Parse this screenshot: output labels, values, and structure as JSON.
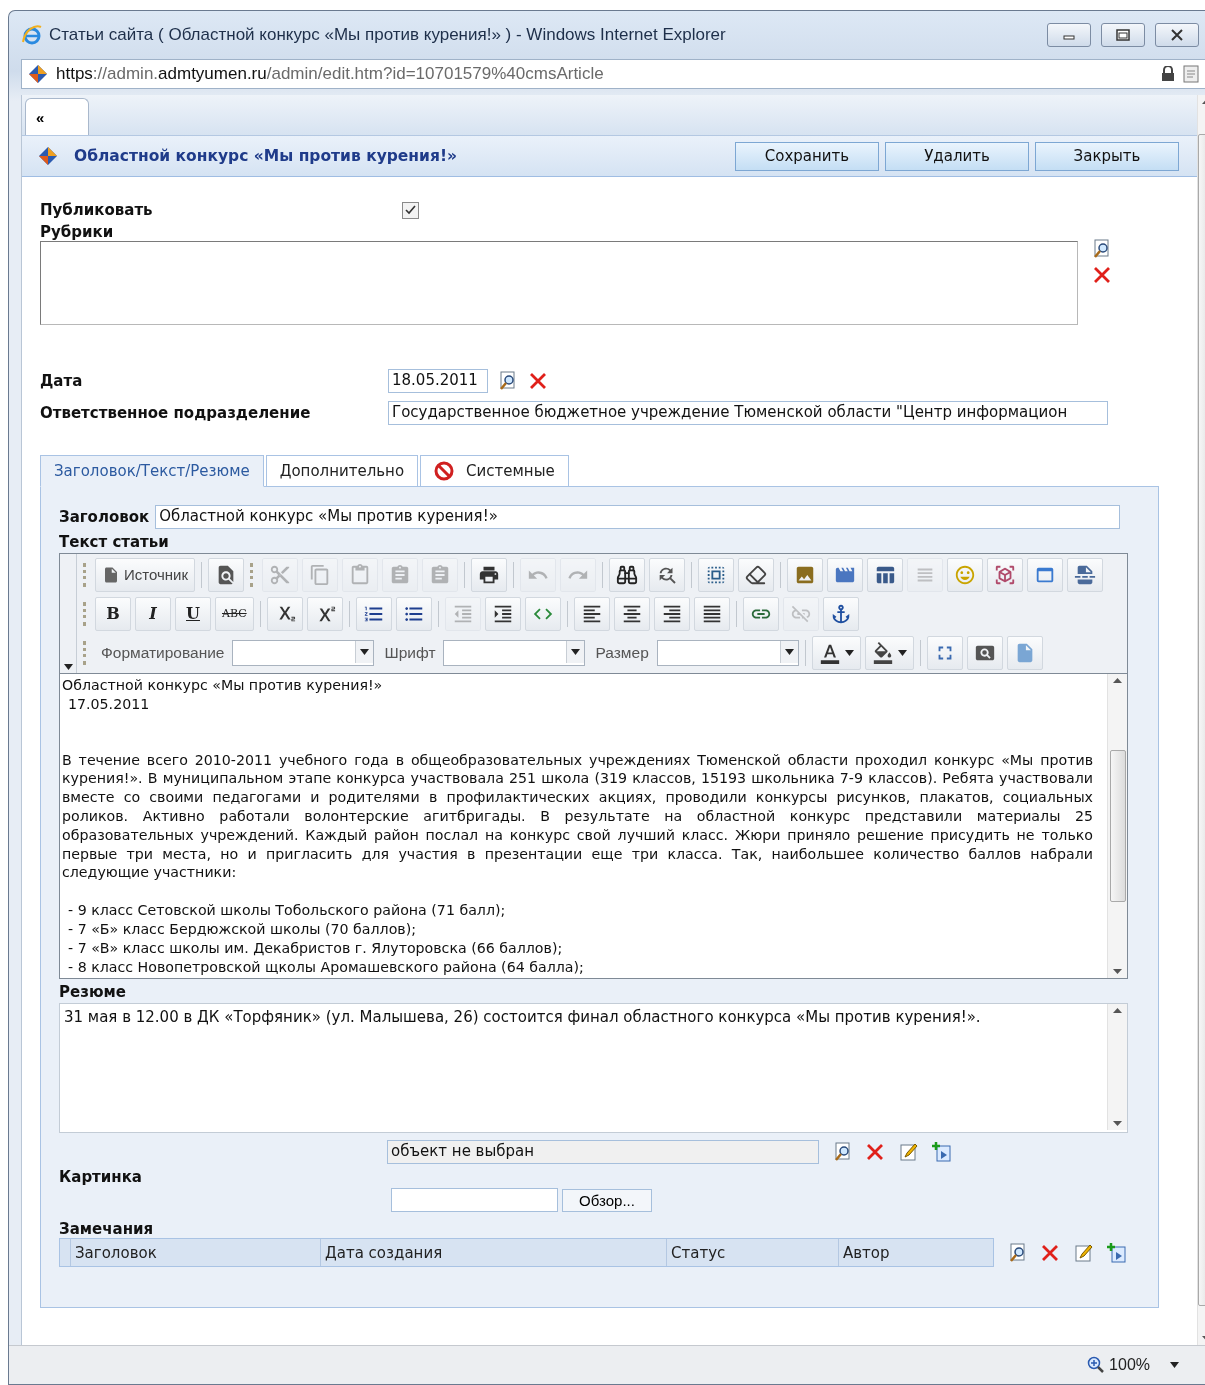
{
  "window": {
    "title": "Статьи сайта ( Областной конкурс «Мы против курения!» ) - Windows Internet Explorer"
  },
  "address_bar": {
    "url": "**https**://admin.**admtyumen.ru**/admin/edit.htm?id=10701579%40cmsArticle"
  },
  "nav_tab": {
    "label": "«"
  },
  "header": {
    "title": "Областной конкурс «Мы против курения!»",
    "buttons": [
      "Сохранить",
      "Удалить",
      "Закрыть"
    ]
  },
  "form": {
    "publish": {
      "label": "Публиковать",
      "checked": true
    },
    "rubrics": {
      "label": "Рубрики"
    },
    "date": {
      "label": "Дата",
      "value": "18.05.2011"
    },
    "department": {
      "label": "Ответственное подразделение",
      "value": "Государственное бюджетное учреждение Тюменской области \"Центр информацион"
    }
  },
  "tabs": [
    {
      "label": "Заголовок/Текст/Резюме",
      "selected": true,
      "kind": "plain"
    },
    {
      "label": "Дополнительно",
      "selected": false,
      "kind": "plain"
    },
    {
      "label": "Системные",
      "selected": false,
      "kind": "icon"
    }
  ],
  "article": {
    "title_label": "Заголовок",
    "title_value": "Областной конкурс «Мы против курения!»",
    "text_label": "Текст статьи",
    "editor": {
      "toolbar": [
        [
          {
            "kind": "grip"
          },
          {
            "kind": "button",
            "label": "Источник"
          },
          {
            "kind": "sep"
          },
          {
            "kind": "icon",
            "disabled": false
          },
          {
            "kind": "grip"
          },
          {
            "kind": "icon",
            "disabled": true
          },
          {
            "kind": "icon",
            "disabled": true
          },
          {
            "kind": "icon",
            "disabled": true
          },
          {
            "kind": "icon",
            "disabled": true
          },
          {
            "kind": "icon",
            "disabled": true
          },
          {
            "kind": "sep"
          },
          {
            "kind": "icon",
            "disabled": false
          },
          {
            "kind": "sep"
          },
          {
            "kind": "icon",
            "disabled": true
          },
          {
            "kind": "icon",
            "disabled": true
          },
          {
            "kind": "sep"
          },
          {
            "kind": "icon",
            "disabled": false
          },
          {
            "kind": "icon",
            "disabled": false
          },
          {
            "kind": "sep"
          },
          {
            "kind": "icon",
            "disabled": false
          },
          {
            "kind": "icon",
            "disabled": false
          },
          {
            "kind": "sep"
          },
          {
            "kind": "icon",
            "disabled": false
          },
          {
            "kind": "icon",
            "disabled": false
          },
          {
            "kind": "icon",
            "disabled": false
          },
          {
            "kind": "icon",
            "disabled": true
          },
          {
            "kind": "icon",
            "disabled": false
          },
          {
            "kind": "icon",
            "disabled": false
          },
          {
            "kind": "icon",
            "disabled": false
          },
          {
            "kind": "icon",
            "disabled": false
          }
        ],
        [
          {
            "kind": "grip"
          },
          {
            "kind": "bold",
            "label": "B"
          },
          {
            "kind": "italic",
            "label": "I"
          },
          {
            "kind": "underline",
            "label": "U"
          },
          {
            "kind": "strike",
            "label": "ABC"
          },
          {
            "kind": "sep"
          },
          {
            "kind": "icon",
            "disabled": false
          },
          {
            "kind": "icon",
            "disabled": false
          },
          {
            "kind": "sep"
          },
          {
            "kind": "icon",
            "disabled": false
          },
          {
            "kind": "icon",
            "disabled": false
          },
          {
            "kind": "sep"
          },
          {
            "kind": "icon",
            "disabled": true
          },
          {
            "kind": "icon",
            "disabled": false
          },
          {
            "kind": "icon",
            "disabled": false
          },
          {
            "kind": "sep"
          },
          {
            "kind": "icon",
            "disabled": false
          },
          {
            "kind": "icon",
            "disabled": false
          },
          {
            "kind": "icon",
            "disabled": false
          },
          {
            "kind": "icon",
            "disabled": false
          },
          {
            "kind": "sep"
          },
          {
            "kind": "icon",
            "disabled": false
          },
          {
            "kind": "icon",
            "disabled": true
          },
          {
            "kind": "icon",
            "disabled": false
          }
        ],
        [
          {
            "kind": "grip"
          },
          {
            "kind": "combo",
            "label": "Форматирование"
          },
          {
            "kind": "combo",
            "label": "Шрифт"
          },
          {
            "kind": "combo",
            "label": "Размер"
          },
          {
            "kind": "sep"
          },
          {
            "kind": "icon_menu",
            "disabled": false
          },
          {
            "kind": "icon_menu",
            "disabled": false
          },
          {
            "kind": "sep"
          },
          {
            "kind": "icon",
            "disabled": false
          },
          {
            "kind": "icon",
            "disabled": false
          },
          {
            "kind": "icon",
            "disabled": false
          }
        ]
      ],
      "content": [
        {
          "kind": "heading",
          "text": "Областной конкурс «Мы против курения!»"
        },
        {
          "kind": "date",
          "text": "17.05.2011"
        },
        {
          "kind": "paragraph",
          "text": "В течение всего 2010-2011 учебного года в общеобразовательных учреждениях Тюменской области проходил конкурс «Мы против курения!». В муниципальном этапе конкурса участвовала 251 школа (319 классов, 15193 школьника  7-9 классов). Ребята участвовали вместе со своими педагогами и родителями в профилактических акциях, проводили конкурсы рисунков, плакатов, социальных роликов. Активно работали волонтерские агитбригады. В результате на областной конкурс представили материалы 25 образовательных учреждений. Каждый район послал на конкурс свой лучший класс. Жюри приняло решение присудить не только первые три места, но и пригласить для участия в презентации еще три класса. Так, наибольшее количество баллов набрали следующие участники:"
        },
        {
          "kind": "list_item",
          "text": "- 9 класс Сетовской школы Тобольского района (71 балл);"
        },
        {
          "kind": "list_item",
          "text": "- 7 «Б» класс Бердюжской школы (70 баллов);"
        },
        {
          "kind": "list_item",
          "text": "- 7 «В» класс школы им. Декабристов г. Ялуторовска (66 баллов);"
        },
        {
          "kind": "list_item",
          "text": "- 8 класс Новопетровской щколы Аромашевского района (64 балла);"
        }
      ]
    },
    "summary_label": "Резюме",
    "summary": "31 мая в 12.00 в ДК «Торфяник» (ул. Малышева, 26) состоится финал областного конкурса «Мы против курения!».",
    "object_field": "объект не выбран",
    "picture_label": "Картинка",
    "browse_button": "Обзор...",
    "remarks_label": "Замечания",
    "remarks_columns": [
      "Заголовок",
      "Дата создания",
      "Статус",
      "Автор"
    ]
  },
  "status_bar": {
    "zoom": "100%"
  }
}
